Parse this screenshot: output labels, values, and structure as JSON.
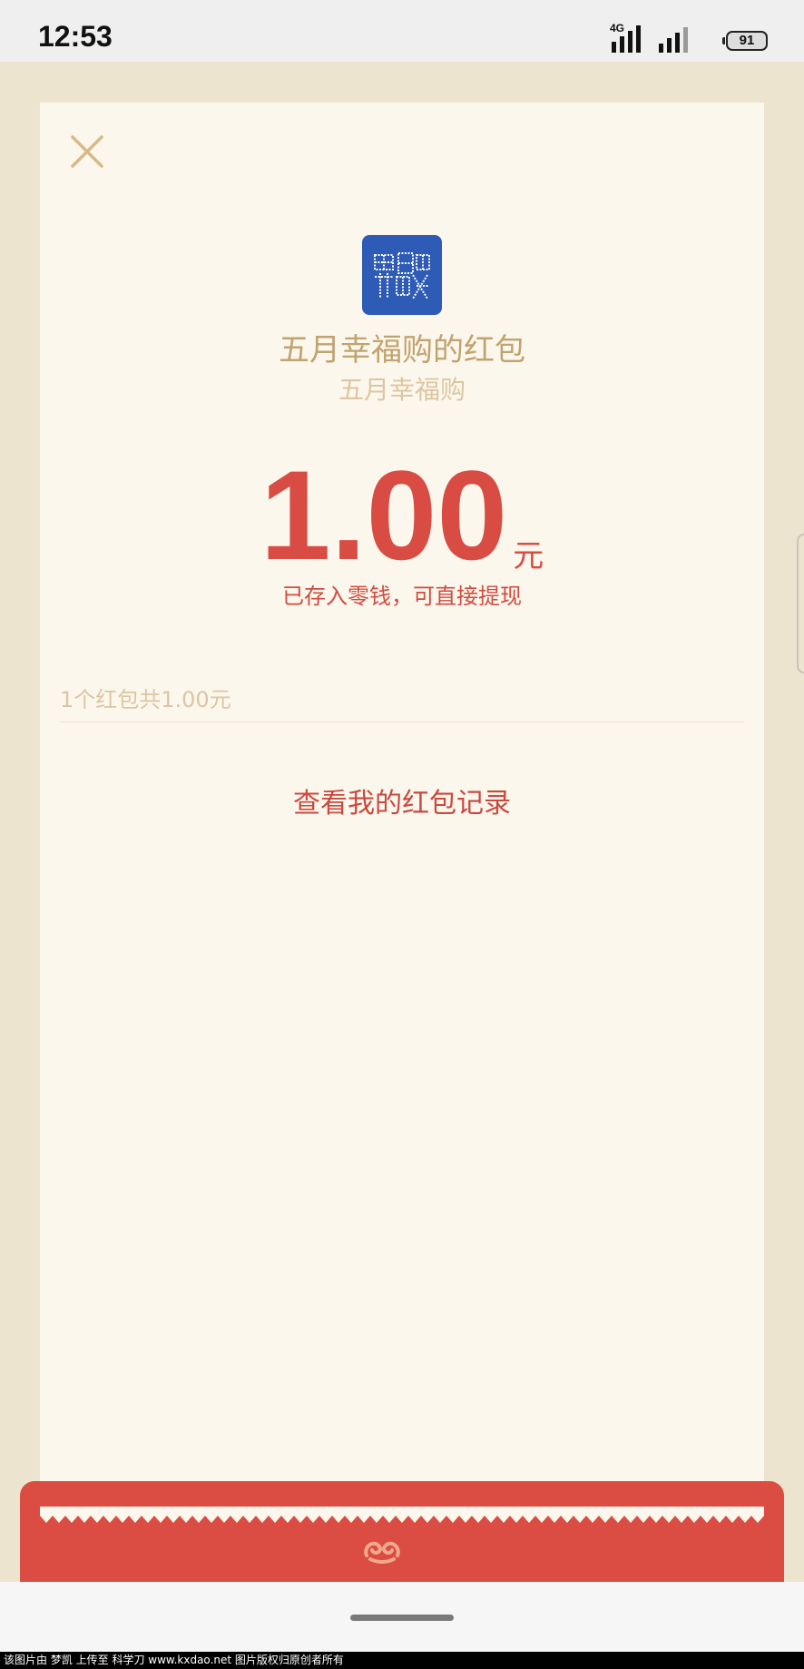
{
  "status_bar": {
    "time": "12:53",
    "network": "4G",
    "battery": "91"
  },
  "card": {
    "close_icon": "close-icon",
    "logo_icon": "merchant-logo",
    "title": "五月幸福购的红包",
    "subtitle": "五月幸福购",
    "amount": "1.00",
    "unit": "元",
    "saved_note": "已存入零钱，可直接提现",
    "summary": "1个红包共1.00元",
    "records_link": "查看我的红包记录"
  },
  "footer": {
    "emblem_icon": "cloud-emblem-icon"
  },
  "watermark": "该图片由 梦凯 上传至 科学刀 www.kxdao.net 图片版权归原创者所有",
  "colors": {
    "background": "#ede4d0",
    "card": "#fcf7ec",
    "accent_red": "#d94c44",
    "gold": "#c1a36f",
    "logo_blue": "#2e5bb5"
  }
}
